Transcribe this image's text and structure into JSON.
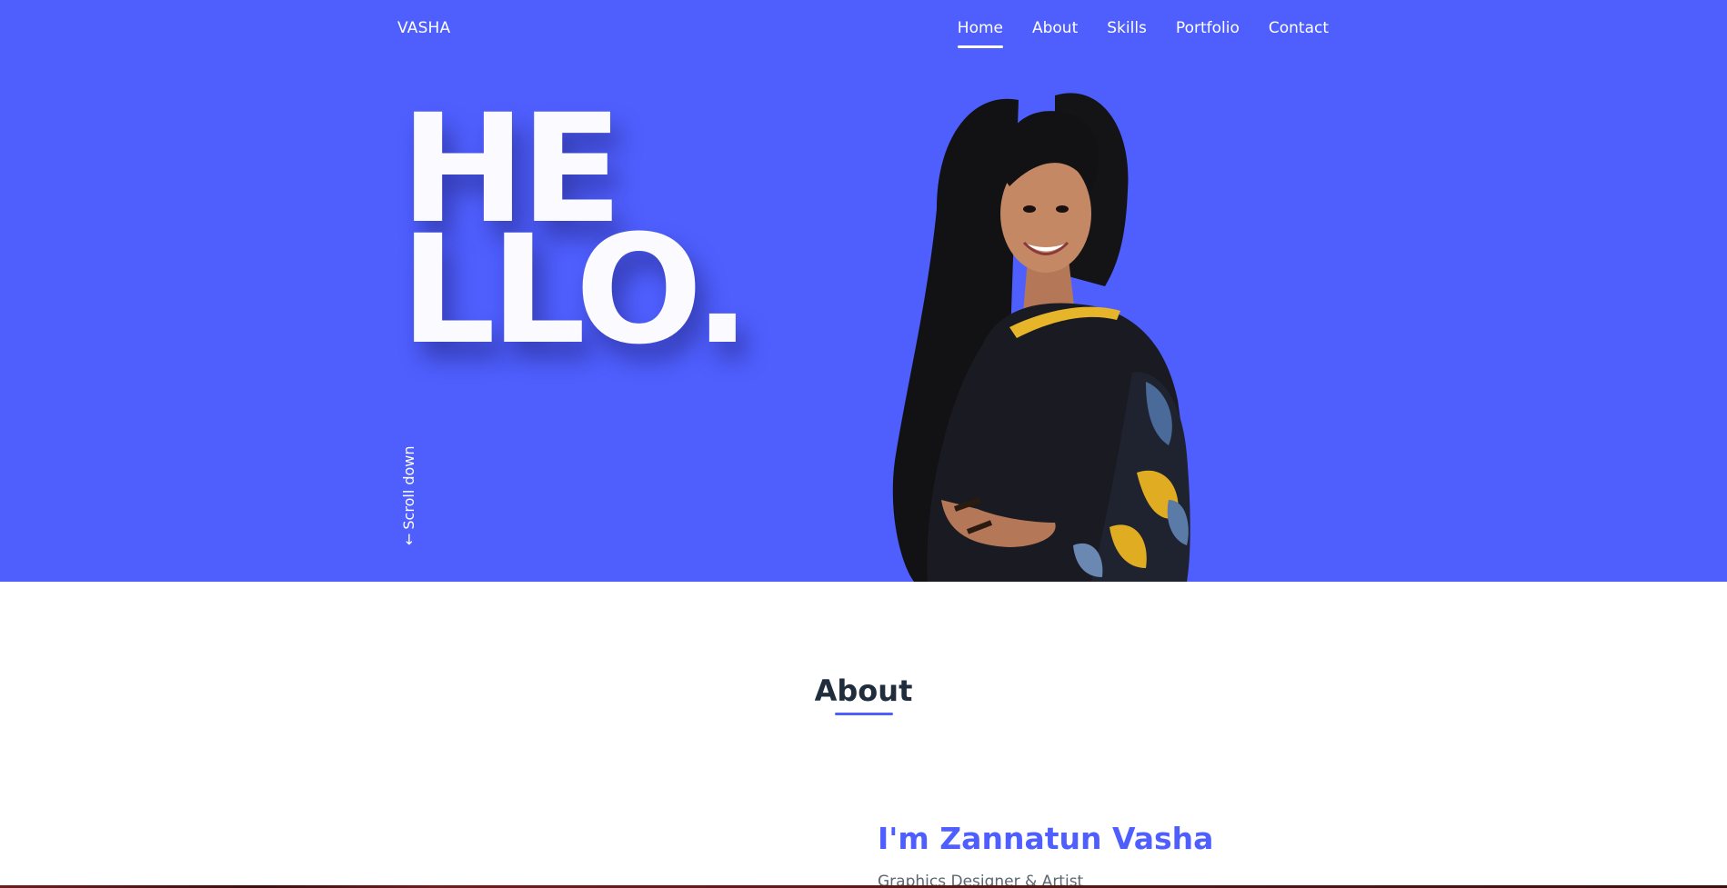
{
  "header": {
    "logo": "VASHA",
    "nav": [
      {
        "label": "Home",
        "active": true
      },
      {
        "label": "About",
        "active": false
      },
      {
        "label": "Skills",
        "active": false
      },
      {
        "label": "Portfolio",
        "active": false
      },
      {
        "label": "Contact",
        "active": false
      }
    ]
  },
  "hero": {
    "line1": "HE",
    "line2": "LLO.",
    "scroll_label": "Scroll down",
    "scroll_icon": "arrow-down-icon",
    "background": "#4f5ffe"
  },
  "about": {
    "title": "About",
    "name": "I'm Zannatun Vasha",
    "role": "Graphics Designer & Artist"
  },
  "colors": {
    "accent": "#4f5ffe",
    "heading": "#1f2d3d",
    "muted": "#5d6670"
  }
}
